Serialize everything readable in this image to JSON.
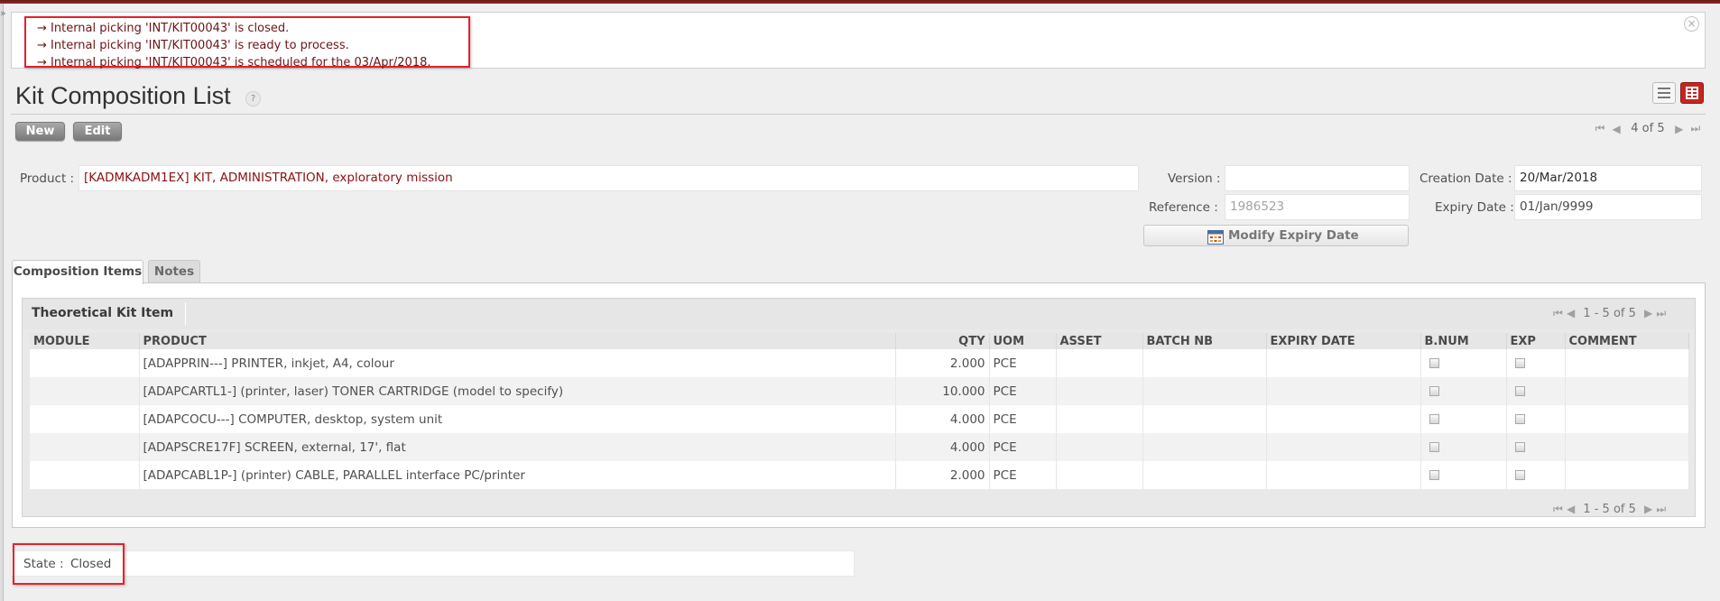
{
  "messages": [
    "→ Internal picking 'INT/KIT00043' is closed.",
    "→ Internal picking 'INT/KIT00043' is ready to process.",
    "→ Internal picking 'INT/KIT00043' is scheduled for the 03/Apr/2018."
  ],
  "page": {
    "title": "Kit Composition List",
    "help": "?"
  },
  "toolbar": {
    "new_label": "New",
    "edit_label": "Edit"
  },
  "pager": {
    "text": "4 of 5"
  },
  "form": {
    "product_label": "Product :",
    "product_value": "[KADMKADM1EX] KIT, ADMINISTRATION, exploratory mission",
    "version_label": "Version :",
    "version_value": "",
    "reference_label": "Reference :",
    "reference_value": "1986523",
    "creation_date_label": "Creation Date :",
    "creation_date_value": "20/Mar/2018",
    "expiry_date_label": "Expiry Date :",
    "expiry_date_value": "01/Jan/9999",
    "modify_expiry_label": "Modify Expiry Date"
  },
  "tabs": [
    {
      "label": "Composition Items",
      "active": true
    },
    {
      "label": "Notes",
      "active": false
    }
  ],
  "grid": {
    "title": "Theoretical Kit Item",
    "pager_text": "1 - 5 of 5",
    "columns": [
      "MODULE",
      "PRODUCT",
      "QTY",
      "UOM",
      "ASSET",
      "BATCH NB",
      "EXPIRY DATE",
      "B.NUM",
      "EXP",
      "COMMENT"
    ],
    "rows": [
      {
        "module": "",
        "product": "[ADAPPRIN---] PRINTER, inkjet, A4, colour",
        "qty": "2.000",
        "uom": "PCE",
        "asset": "",
        "batch": "",
        "expiry": "",
        "comment": ""
      },
      {
        "module": "",
        "product": "[ADAPCARTL1-] (printer, laser) TONER CARTRIDGE (model to specify)",
        "qty": "10.000",
        "uom": "PCE",
        "asset": "",
        "batch": "",
        "expiry": "",
        "comment": ""
      },
      {
        "module": "",
        "product": "[ADAPCOCU---] COMPUTER, desktop, system unit",
        "qty": "4.000",
        "uom": "PCE",
        "asset": "",
        "batch": "",
        "expiry": "",
        "comment": ""
      },
      {
        "module": "",
        "product": "[ADAPSCRE17F] SCREEN, external, 17', flat",
        "qty": "4.000",
        "uom": "PCE",
        "asset": "",
        "batch": "",
        "expiry": "",
        "comment": ""
      },
      {
        "module": "",
        "product": "[ADAPCABL1P-] (printer) CABLE, PARALLEL interface PC/printer",
        "qty": "2.000",
        "uom": "PCE",
        "asset": "",
        "batch": "",
        "expiry": "",
        "comment": ""
      }
    ]
  },
  "state": {
    "label": "State :",
    "value": "Closed"
  },
  "icons": {
    "close": "close-icon",
    "first": "first-page-icon",
    "prev": "previous-page-icon",
    "next": "next-page-icon",
    "last": "last-page-icon",
    "calendar": "calendar-icon",
    "list_view": "list-view-icon",
    "form_view": "form-view-icon"
  },
  "colors": {
    "accent": "#c2271f",
    "message_text": "#6d1414",
    "highlight": "#e8202a"
  }
}
